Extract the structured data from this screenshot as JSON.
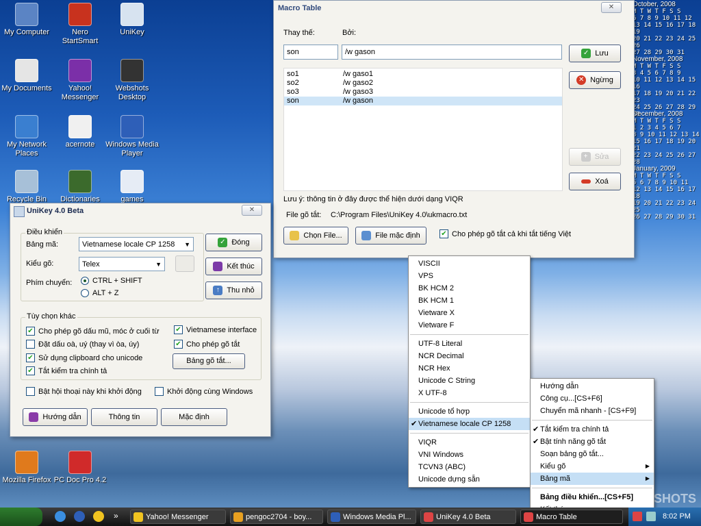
{
  "desktop": {
    "icons": [
      {
        "label": "My Computer",
        "color": "#5b84c4"
      },
      {
        "label": "Nero StartSmart",
        "color": "#c8321e"
      },
      {
        "label": "UniKey",
        "color": "#d7e3f0"
      },
      {
        "label": "My Documents",
        "color": "#e5e5e5"
      },
      {
        "label": "Yahoo! Messenger",
        "color": "#7b2fa8"
      },
      {
        "label": "Webshots Desktop",
        "color": "#333333"
      },
      {
        "label": "My Network Places",
        "color": "#3a7fd0"
      },
      {
        "label": "acernote",
        "color": "#f0f0f0"
      },
      {
        "label": "Windows Media Player",
        "color": "#2e5fb8"
      },
      {
        "label": "Recycle Bin",
        "color": "#a7c0d8"
      },
      {
        "label": "Dictionaries",
        "color": "#3b6a2c"
      },
      {
        "label": "games",
        "color": "#e6ecf5"
      },
      {
        "label": "Mozilla Firefox",
        "color": "#e07a1c"
      },
      {
        "label": "PC Doc Pro 4.2",
        "color": "#d02a2a"
      }
    ],
    "watermark": "SHOTS"
  },
  "calendar": [
    {
      "title": "October, 2008",
      "header": "M T W T F S S",
      "rows": [
        "6 7 8 9 10 11 12",
        "13 14 15 16 17 18 19",
        "20 21 22 23 24 25 26",
        "27 28 29 30 31"
      ]
    },
    {
      "title": "November, 2008",
      "header": "M T W T F S S",
      "rows": [
        "3 4 5 6 7 8 9",
        "10 11 12 13 14 15 16",
        "17 18 19 20 21 22 23",
        "24 25 26 27 28 29 30"
      ]
    },
    {
      "title": "December, 2008",
      "header": "M T W T F S S",
      "rows": [
        "1 2 3 4 5 6 7",
        "8 9 10 11 12 13 14",
        "15 16 17 18 19 20 21",
        "22 23 24 25 26 27 28"
      ]
    },
    {
      "title": "January, 2009",
      "header": "M T W T F S S",
      "rows": [
        "5 6 7 8 9 10 11",
        "12 13 14 15 16 17 18",
        "19 20 21 22 23 24 25",
        "26 27 28 29 30 31"
      ]
    }
  ],
  "macro": {
    "title": "Macro Table",
    "close": "✕",
    "replace_label": "Thay thế:",
    "by_label": "Bởi:",
    "replace_value": "son",
    "by_value": "/w gason",
    "rows": [
      {
        "key": "so1",
        "value": "/w gaso1"
      },
      {
        "key": "so2",
        "value": "/w gaso2"
      },
      {
        "key": "so3",
        "value": "/w gaso3"
      },
      {
        "key": "son",
        "value": "/w gason"
      }
    ],
    "save": "Lưu",
    "stop": "Ngừng",
    "edit": "Sửa",
    "delete": "Xoá",
    "note": "Lưu ý: thông tin ở đây được thể hiện dưới dạng VIQR",
    "file_label": "File gõ tắt:",
    "file_path": "C:\\Program Files\\UniKey 4.0\\ukmacro.txt",
    "choose_file": "Chọn File...",
    "default_file": "File mặc định",
    "allow_label": "Cho phép gõ tắt cả khi tắt tiếng Việt"
  },
  "unikey": {
    "title": "UniKey 4.0 Beta",
    "close": "✕",
    "group_control": "Điều khiển",
    "charset_label": "Bảng mã:",
    "charset_value": "Vietnamese locale CP 1258",
    "input_label": "Kiểu gõ:",
    "input_value": "Telex",
    "switch_label": "Phím chuyển:",
    "switch_opt1": "CTRL + SHIFT",
    "switch_opt2": "ALT + Z",
    "btn_close": "Đóng",
    "btn_exit": "Kết thúc",
    "btn_minimize": "Thu nhỏ",
    "group_options": "Tùy chọn khác",
    "opt1": "Cho phép gõ dấu mũ, móc ở cuối từ",
    "opt2": "Đặt dấu oà, uý (thay vì òa, úy)",
    "opt3": "Sử dụng clipboard cho unicode",
    "opt4": "Tắt kiểm tra chính tả",
    "opt5": "Vietnamese interface",
    "opt6": "Cho phép gõ tắt",
    "macro_btn": "Bảng gõ tắt...",
    "startup1": "Bật hội thoại này khi khởi động",
    "startup2": "Khởi động cùng Windows",
    "help": "Hướng dẫn",
    "info": "Thông tin",
    "default": "Mặc định"
  },
  "charset_menu": {
    "groups": [
      [
        "VISCII",
        "VPS",
        "BK HCM 2",
        "BK HCM 1",
        "Vietware X",
        "Vietware F"
      ],
      [
        "UTF-8 Literal",
        "NCR Decimal",
        "NCR Hex",
        "Unicode C String",
        "X UTF-8"
      ],
      [
        "Unicode tổ hợp",
        "Vietnamese locale CP 1258"
      ],
      [
        "VIQR",
        "VNI Windows",
        "TCVN3 (ABC)",
        "Unicode dựng sẵn"
      ]
    ],
    "selected": "Vietnamese locale CP 1258"
  },
  "context_menu": {
    "items": [
      {
        "label": "Hướng dẫn"
      },
      {
        "label": "Công cụ...[CS+F6]"
      },
      {
        "label": "Chuyển mã nhanh - [CS+F9]"
      },
      {
        "label": "Tắt kiểm tra chính tả"
      },
      {
        "label": "Bật tính năng gõ tắt"
      },
      {
        "label": "Soạn bảng gõ tắt..."
      },
      {
        "label": "Kiểu gõ"
      },
      {
        "label": "Bảng mã"
      },
      {
        "label": "Bảng điều khiển...[CS+F5]"
      },
      {
        "label": "Kết thúc"
      }
    ]
  },
  "taskbar": {
    "items": [
      "Yahoo! Messenger",
      "pengoc2704 - boy...",
      "Windows Media Pl...",
      "UniKey 4.0 Beta",
      "Macro Table"
    ],
    "clock": "8:02 PM",
    "chevron": "»"
  }
}
